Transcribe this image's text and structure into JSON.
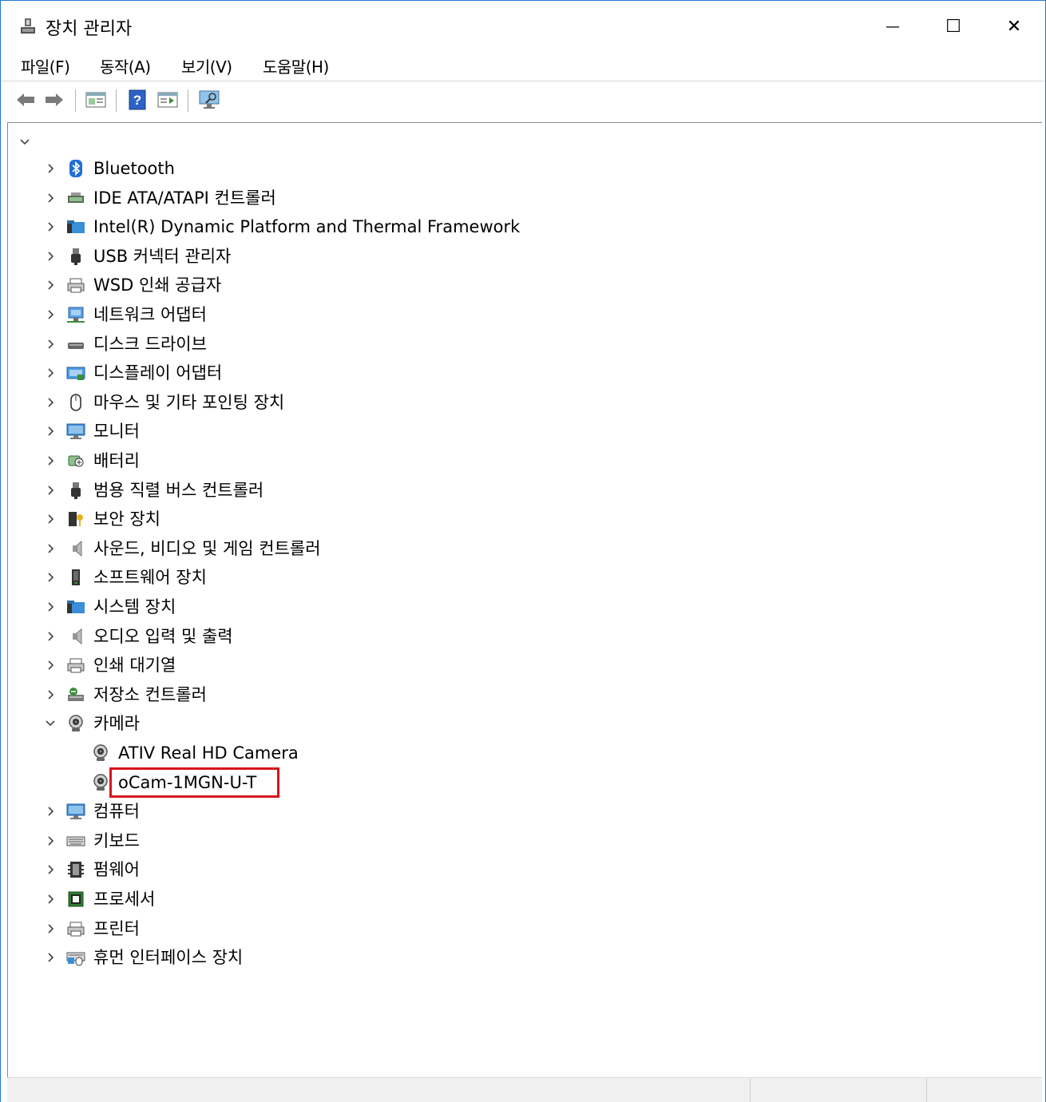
{
  "window": {
    "title": "장치 관리자"
  },
  "window_controls": {
    "minimize": "—",
    "maximize": "☐",
    "close": "✕"
  },
  "menu": [
    "파일(F)",
    "동작(A)",
    "보기(V)",
    "도움말(H)"
  ],
  "toolbar": {
    "buttons": [
      "back-icon",
      "forward-icon",
      "properties-icon",
      "help-icon",
      "view-icon",
      "monitor-icon"
    ]
  },
  "tree": {
    "root_expanded": true,
    "categories": [
      {
        "label": "Bluetooth",
        "icon": "bluetooth-icon",
        "expanded": false
      },
      {
        "label": "IDE ATA/ATAPI 컨트롤러",
        "icon": "ide-controller-icon",
        "expanded": false
      },
      {
        "label": "Intel(R) Dynamic Platform and Thermal Framework",
        "icon": "folder-device-icon",
        "expanded": false
      },
      {
        "label": "USB 커넥터 관리자",
        "icon": "usb-icon",
        "expanded": false
      },
      {
        "label": "WSD 인쇄 공급자",
        "icon": "printer-icon",
        "expanded": false
      },
      {
        "label": "네트워크 어댑터",
        "icon": "network-icon",
        "expanded": false
      },
      {
        "label": "디스크 드라이브",
        "icon": "disk-drive-icon",
        "expanded": false
      },
      {
        "label": "디스플레이 어댑터",
        "icon": "display-adapter-icon",
        "expanded": false
      },
      {
        "label": "마우스 및 기타 포인팅 장치",
        "icon": "mouse-icon",
        "expanded": false
      },
      {
        "label": "모니터",
        "icon": "monitor-icon",
        "expanded": false
      },
      {
        "label": "배터리",
        "icon": "battery-icon",
        "expanded": false
      },
      {
        "label": "범용 직렬 버스 컨트롤러",
        "icon": "usb-icon",
        "expanded": false
      },
      {
        "label": "보안 장치",
        "icon": "security-device-icon",
        "expanded": false
      },
      {
        "label": "사운드, 비디오 및 게임 컨트롤러",
        "icon": "speaker-icon",
        "expanded": false
      },
      {
        "label": "소프트웨어 장치",
        "icon": "software-device-icon",
        "expanded": false
      },
      {
        "label": "시스템 장치",
        "icon": "folder-device-icon",
        "expanded": false
      },
      {
        "label": "오디오 입력 및 출력",
        "icon": "speaker-icon",
        "expanded": false
      },
      {
        "label": "인쇄 대기열",
        "icon": "printer-icon",
        "expanded": false
      },
      {
        "label": "저장소 컨트롤러",
        "icon": "storage-controller-icon",
        "expanded": false
      },
      {
        "label": "카메라",
        "icon": "webcam-icon",
        "expanded": true,
        "children": [
          {
            "label": "ATIV Real HD Camera",
            "icon": "webcam-icon",
            "highlighted": false
          },
          {
            "label": "oCam-1MGN-U-T",
            "icon": "webcam-icon",
            "highlighted": true
          }
        ]
      },
      {
        "label": "컴퓨터",
        "icon": "monitor-icon",
        "expanded": false
      },
      {
        "label": "키보드",
        "icon": "keyboard-icon",
        "expanded": false
      },
      {
        "label": "펌웨어",
        "icon": "firmware-icon",
        "expanded": false
      },
      {
        "label": "프로세서",
        "icon": "processor-icon",
        "expanded": false
      },
      {
        "label": "프린터",
        "icon": "printer-icon",
        "expanded": false
      },
      {
        "label": "휴먼 인터페이스 장치",
        "icon": "hid-icon",
        "expanded": false
      }
    ]
  },
  "colors": {
    "highlight_border": "#d7141e",
    "window_border": "#1e7ad3"
  }
}
